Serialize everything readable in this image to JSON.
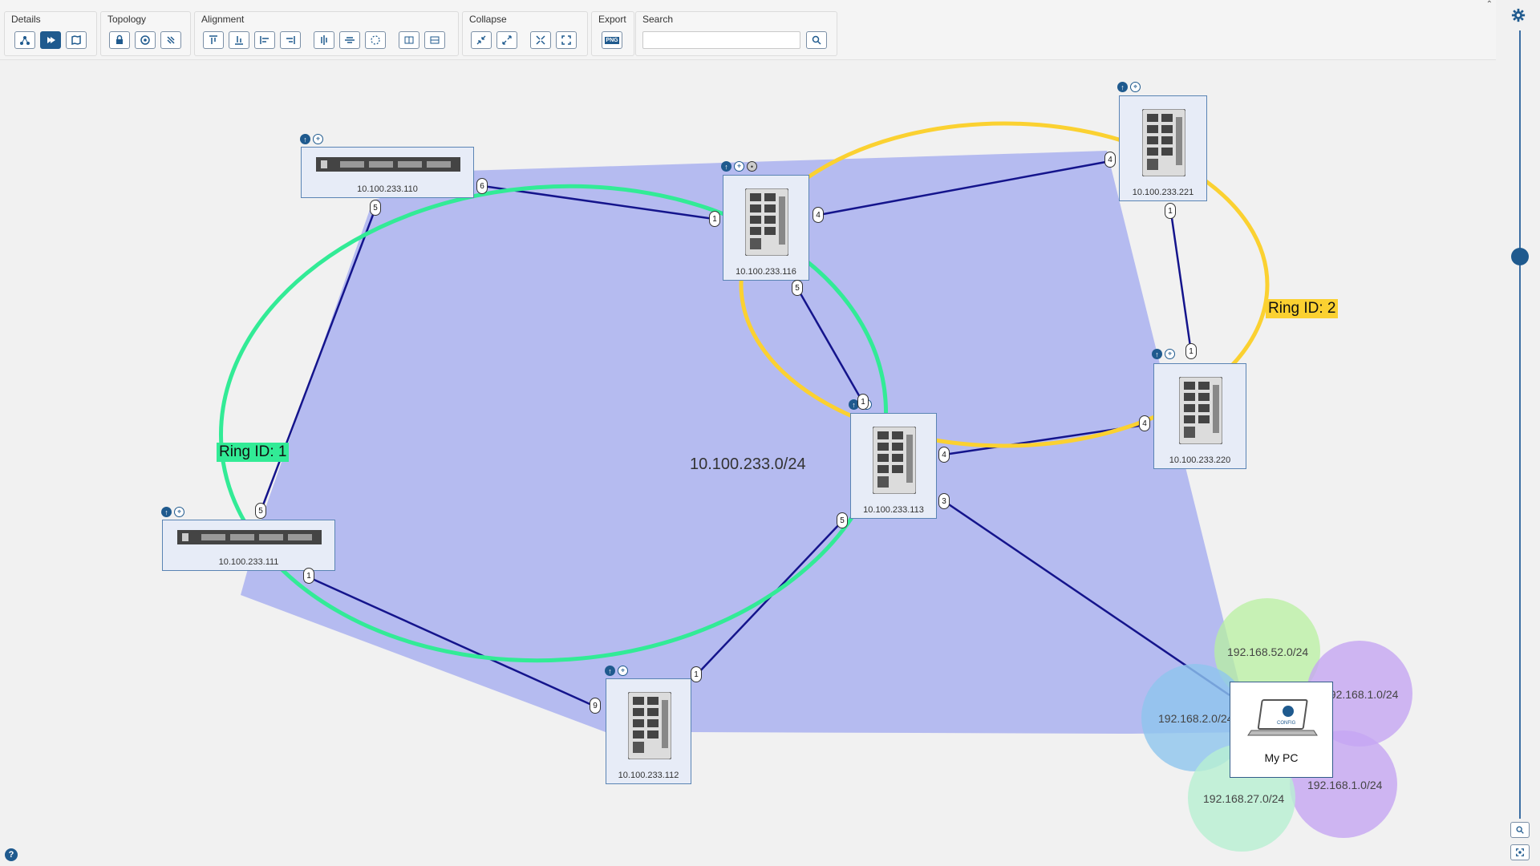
{
  "toolbar": {
    "details_label": "Details",
    "topology_label": "Topology",
    "alignment_label": "Alignment",
    "collapse_label": "Collapse",
    "export_label": "Export",
    "search_label": "Search",
    "search_placeholder": "",
    "export_icon_text": "PNG"
  },
  "network": {
    "subnet_label": "10.100.233.0/24",
    "ring1_label": "Ring ID: 1",
    "ring2_label": "Ring ID: 2",
    "colors": {
      "ring1": "#32eb96",
      "ring2": "#fbd131",
      "subnet_fill": "#a6aef0",
      "link": "#14148c"
    }
  },
  "nodes": {
    "n110": {
      "ip": "10.100.233.110"
    },
    "n111": {
      "ip": "10.100.233.111"
    },
    "n116": {
      "ip": "10.100.233.116"
    },
    "n113": {
      "ip": "10.100.233.113"
    },
    "n112": {
      "ip": "10.100.233.112"
    },
    "n221": {
      "ip": "10.100.233.221"
    },
    "n220": {
      "ip": "10.100.233.220"
    },
    "mypc": {
      "label": "My PC",
      "screen_text": "CONFIG"
    }
  },
  "ports": {
    "p110_6": "6",
    "p110_5": "5",
    "p111_5": "5",
    "p111_1": "1",
    "p116_1": "1",
    "p116_4": "4",
    "p116_5": "5",
    "p113_1": "1",
    "p113_4": "4",
    "p113_3": "3",
    "p113_5": "5",
    "p112_1": "1",
    "p112_9": "9",
    "p221_4": "4",
    "p221_1": "1",
    "p220_1": "1",
    "p220_4": "4"
  },
  "subnets": {
    "s1": "192.168.52.0/24",
    "s2": "192.168.2.0/24",
    "s3": "192.168.1.0/24",
    "s4": "192.168.1.0/24",
    "s5": "192.168.27.0/24"
  },
  "help_text": "?"
}
